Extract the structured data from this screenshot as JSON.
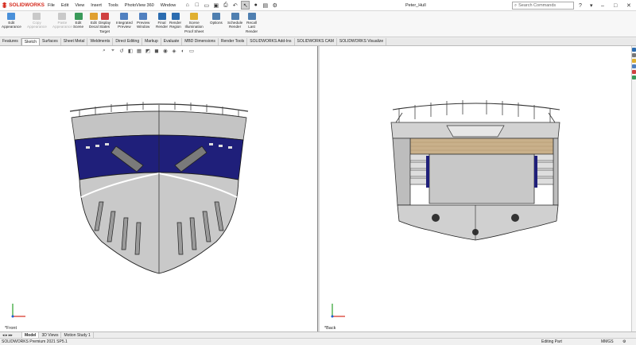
{
  "app": {
    "logo_text": "SOLIDWORKS",
    "doc_title": "Peter_Hull",
    "search_placeholder": "Search Commands"
  },
  "menu": [
    "File",
    "Edit",
    "View",
    "Insert",
    "Tools",
    "PhotoView 360",
    "Window"
  ],
  "commands": [
    {
      "label": "Edit\nAppearance",
      "enabled": true,
      "color": "#4a90d9"
    },
    {
      "label": "Copy\nAppearance",
      "enabled": false,
      "color": "#c9c9c9"
    },
    {
      "label": "Paste\nAppearance",
      "enabled": false,
      "color": "#c9c9c9"
    },
    {
      "label": "Edit\nScene",
      "enabled": true,
      "color": "#3a9a5a"
    },
    {
      "label": "Edit\nDecal",
      "enabled": true,
      "color": "#e0a030"
    },
    {
      "label": "Display\nStates\nTarget",
      "enabled": true,
      "color": "#d04040"
    },
    {
      "label": "Integrated\nPreview",
      "enabled": true,
      "color": "#5080c0"
    },
    {
      "label": "Preview\nWindow",
      "enabled": true,
      "color": "#5080c0"
    },
    {
      "label": "Final\nRender",
      "enabled": true,
      "color": "#2b6cb0"
    },
    {
      "label": "Render\nRegion",
      "enabled": true,
      "color": "#2b6cb0"
    },
    {
      "label": "Scene\nIllumination\nProof Sheet",
      "enabled": true,
      "color": "#e0b030"
    },
    {
      "label": "Options",
      "enabled": true,
      "color": "#4f7fb0"
    },
    {
      "label": "Schedule\nRender",
      "enabled": true,
      "color": "#4f7fb0"
    },
    {
      "label": "Recall\nLast\nRender",
      "enabled": true,
      "color": "#4f7fb0"
    }
  ],
  "tabs": [
    "Features",
    "Sketch",
    "Surfaces",
    "Sheet Metal",
    "Weldments",
    "Direct Editing",
    "Markup",
    "Evaluate",
    "MBD Dimensions",
    "Render Tools",
    "SOLIDWORKS Add-Ins",
    "SOLIDWORKS CAM",
    "SOLIDWORKS Visualize"
  ],
  "active_tab": "Sketch",
  "viewports": {
    "left_label": "*Front",
    "right_label": "*Back"
  },
  "bottom_tabs": [
    "Model",
    "3D Views",
    "Motion Study 1"
  ],
  "status": {
    "version": "SOLIDWORKS Premium 2021 SP5.1",
    "mode": "Editing Part",
    "units": "MMGS"
  },
  "colors": {
    "hull_blue": "#1f1f7a",
    "hull_grey": "#bfbfbf",
    "deck_wood": "#c9b08a",
    "accent_red": "#d52b1e"
  }
}
